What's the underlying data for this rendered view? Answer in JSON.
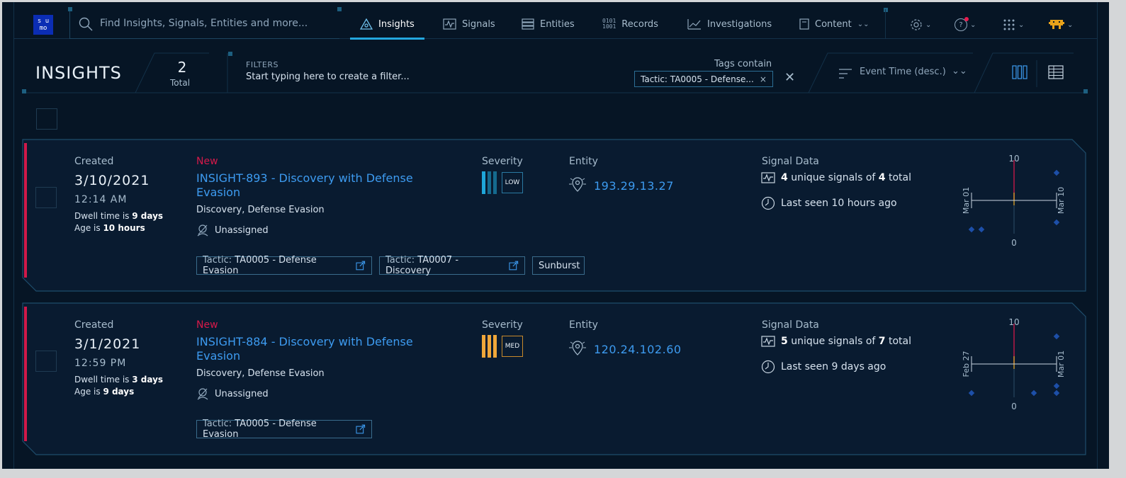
{
  "nav": {
    "logo_top": "s u",
    "logo_bottom": "mo",
    "search_placeholder": "Find Insights, Signals, Entities and more...",
    "items": [
      {
        "label": "Insights"
      },
      {
        "label": "Signals"
      },
      {
        "label": "Entities"
      },
      {
        "label": "Records"
      },
      {
        "label": "Investigations"
      },
      {
        "label": "Content"
      }
    ],
    "help_label": "?"
  },
  "header": {
    "title": "INSIGHTS",
    "total_count": "2",
    "total_label": "Total",
    "filters_label": "FILTERS",
    "filters_placeholder": "Start typing here to create a filter...",
    "tags_label": "Tags contain",
    "tag_chip": "Tactic: TA0005 - Defense...",
    "tag_chip_remove": "×",
    "clear": "✕",
    "sort_label": "Event Time (desc.)"
  },
  "labels": {
    "created": "Created",
    "severity": "Severity",
    "entity": "Entity",
    "signal_data": "Signal Data"
  },
  "insights": [
    {
      "status": "New",
      "title": "INSIGHT-893 - Discovery with Defense Evasion",
      "tactics": "Discovery, Defense Evasion",
      "assignee": "Unassigned",
      "created_date": "3/10/2021",
      "created_time": "12:14 AM",
      "dwell_prefix": "Dwell time is ",
      "dwell": "9 days",
      "age_prefix": "Age is ",
      "age": "10 hours",
      "severity": "LOW",
      "severity_color": "#1fa6d9",
      "entity": "193.29.13.27",
      "unique_signals": "4",
      "unique_mid": " unique signals of ",
      "total_signals": "4",
      "total_suffix": " total",
      "last_seen": "Last seen 10 hours ago",
      "tags": [
        {
          "key": "Tactic: ",
          "value": "TA0005 - Defense Evasion",
          "link": true
        },
        {
          "key": "Tactic: ",
          "value": "TA0007 - Discovery",
          "link": true
        },
        {
          "key": "",
          "value": "Sunburst",
          "link": false
        }
      ],
      "timeline": {
        "y_max": "10",
        "y_min": "0",
        "start": "Mar 01",
        "end": "Mar 10"
      }
    },
    {
      "status": "New",
      "title": "INSIGHT-884 - Discovery with Defense Evasion",
      "tactics": "Discovery, Defense Evasion",
      "assignee": "Unassigned",
      "created_date": "3/1/2021",
      "created_time": "12:59 PM",
      "dwell_prefix": "Dwell time is ",
      "dwell": "3 days",
      "age_prefix": "Age is ",
      "age": "9 days",
      "severity": "MED",
      "severity_color": "#f0a73a",
      "entity": "120.24.102.60",
      "unique_signals": "5",
      "unique_mid": " unique signals of ",
      "total_signals": "7",
      "total_suffix": " total",
      "last_seen": "Last seen 9 days ago",
      "tags": [
        {
          "key": "Tactic: ",
          "value": "TA0005 - Defense Evasion",
          "link": true
        }
      ],
      "timeline": {
        "y_max": "10",
        "y_min": "0",
        "start": "Feb 27",
        "end": "Mar 01"
      }
    }
  ]
}
